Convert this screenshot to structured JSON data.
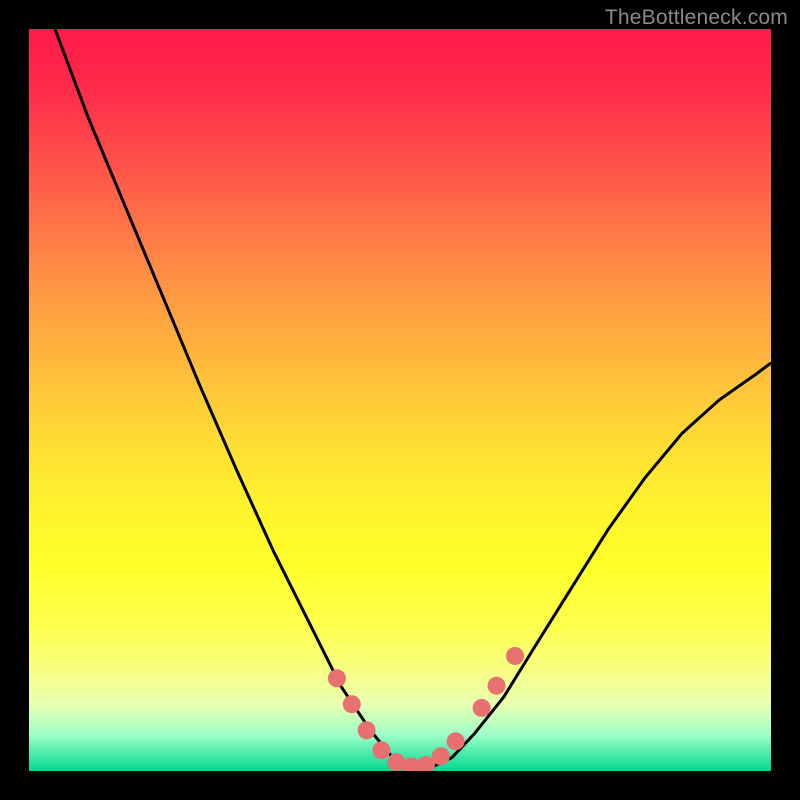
{
  "watermark": "TheBottleneck.com",
  "chart_data": {
    "type": "line",
    "title": "",
    "xlabel": "",
    "ylabel": "",
    "series": [
      {
        "name": "curve",
        "x": [
          0.035,
          0.08,
          0.13,
          0.18,
          0.23,
          0.28,
          0.33,
          0.38,
          0.42,
          0.46,
          0.49,
          0.515,
          0.54,
          0.57,
          0.6,
          0.64,
          0.68,
          0.73,
          0.78,
          0.83,
          0.88,
          0.93,
          0.98,
          1.0
        ],
        "y": [
          1.0,
          0.88,
          0.76,
          0.64,
          0.52,
          0.405,
          0.295,
          0.195,
          0.115,
          0.055,
          0.018,
          0.004,
          0.004,
          0.018,
          0.05,
          0.1,
          0.165,
          0.245,
          0.325,
          0.395,
          0.455,
          0.5,
          0.535,
          0.55
        ]
      }
    ],
    "markers": {
      "x": [
        0.415,
        0.435,
        0.455,
        0.475,
        0.495,
        0.515,
        0.535,
        0.555,
        0.575,
        0.61,
        0.63,
        0.655
      ],
      "y": [
        0.125,
        0.09,
        0.055,
        0.028,
        0.012,
        0.006,
        0.008,
        0.02,
        0.04,
        0.085,
        0.115,
        0.155
      ]
    },
    "xlim": [
      0,
      1
    ],
    "ylim": [
      0,
      1
    ]
  }
}
